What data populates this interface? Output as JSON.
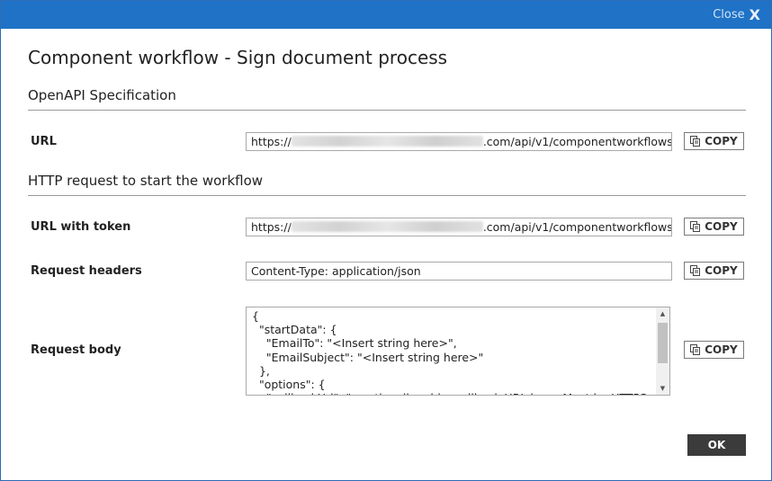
{
  "window": {
    "close_label": "Close",
    "close_glyph": "X"
  },
  "title": "Component workflow - Sign document process",
  "openapi": {
    "heading": "OpenAPI Specification",
    "url_label": "URL",
    "url_prefix": "https://",
    "url_suffix": ".com/api/v1/componentworkflows",
    "copy_label": "COPY"
  },
  "http": {
    "heading": "HTTP request to start the workflow",
    "token_label": "URL with token",
    "token_prefix": "https://",
    "token_suffix": ".com/api/v1/componentworkflows",
    "headers_label": "Request headers",
    "headers_value": "Content-Type: application/json",
    "body_label": "Request body",
    "body_value": "{\n  \"startData\": {\n    \"EmailTo\": \"<Insert string here>\",\n    \"EmailSubject\": \"<Insert string here>\"\n  },\n  \"options\": {\n    \"callbackUrl\": \"<optionally add a callback URL here. Must be HTTPS>\"",
    "copy_label": "COPY"
  },
  "footer": {
    "ok_label": "OK"
  },
  "colors": {
    "titlebar": "#1f72c6",
    "ok_button": "#3b3b3b"
  },
  "icons": [
    "close-icon",
    "copy-icon",
    "scroll-up-icon",
    "scroll-down-icon"
  ]
}
